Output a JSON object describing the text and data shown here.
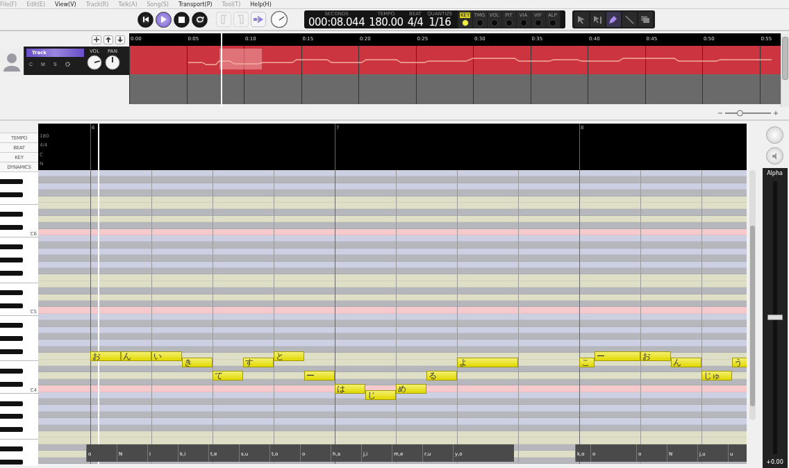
{
  "menu": [
    {
      "label": "File(F)",
      "disabled": true
    },
    {
      "label": "Edit(E)",
      "disabled": true
    },
    {
      "label": "View(V)",
      "disabled": false
    },
    {
      "label": "Track(R)",
      "disabled": true
    },
    {
      "label": "Talk(A)",
      "disabled": true
    },
    {
      "label": "Song(S)",
      "disabled": true
    },
    {
      "label": "Transport(P)",
      "disabled": false
    },
    {
      "label": "Tool(T)",
      "disabled": true
    },
    {
      "label": "Help(H)",
      "disabled": false
    }
  ],
  "transport": [
    {
      "kind": "rewind",
      "selected": false
    },
    {
      "kind": "play",
      "selected": true
    },
    {
      "kind": "stop",
      "selected": false
    },
    {
      "kind": "loop",
      "selected": false
    }
  ],
  "edit_buttons": [
    {
      "kind": "bracket-left",
      "disabled": true
    },
    {
      "kind": "bracket-right",
      "disabled": true
    },
    {
      "kind": "auto-scroll",
      "disabled": false
    }
  ],
  "display": [
    {
      "label": "SECONDS",
      "value": "000:08.044"
    },
    {
      "label": "TEMPO",
      "value": "180.00"
    },
    {
      "label": "BEAT",
      "value": "4/4"
    },
    {
      "label": "QUANTIZE",
      "value": "1/16"
    }
  ],
  "lane_switches": [
    {
      "label": "KEY",
      "on": true
    },
    {
      "label": "TMG",
      "on": false
    },
    {
      "label": "VOL",
      "on": false
    },
    {
      "label": "PIT",
      "on": false
    },
    {
      "label": "VIA",
      "on": false
    },
    {
      "label": "VIF",
      "on": false
    },
    {
      "label": "ALP",
      "on": false
    }
  ],
  "tools": [
    {
      "kind": "arrow",
      "selected": false
    },
    {
      "kind": "range-arrow",
      "selected": false
    },
    {
      "kind": "pencil",
      "selected": true
    },
    {
      "kind": "line",
      "selected": false
    },
    {
      "kind": "layers",
      "selected": false
    }
  ],
  "track": {
    "name": "Track",
    "buttons": [
      "C",
      "M",
      "S"
    ],
    "knobs": [
      "VOL",
      "PAN"
    ]
  },
  "timeline": [
    "0:00",
    "0:05",
    "0:10",
    "0:15",
    "0:20",
    "0:25",
    "0:30",
    "0:35",
    "0:40",
    "0:45",
    "0:50",
    "0:55"
  ],
  "timeline_zoom": {
    "level": 0.3
  },
  "editor": {
    "measures": [
      "6",
      "7",
      "8"
    ],
    "lanes": [
      {
        "label": "TEMPO",
        "value": "180"
      },
      {
        "label": "BEAT",
        "value": "4/4"
      },
      {
        "label": "KEY",
        "value": "C"
      },
      {
        "label": "DYNAMICS",
        "value": "N"
      }
    ],
    "octave_labels": [
      "C6",
      "C5",
      "C4"
    ],
    "notes": [
      {
        "lyric": "お"
      },
      {
        "lyric": "ん"
      },
      {
        "lyric": "い"
      },
      {
        "lyric": "き"
      },
      {
        "lyric": "て"
      },
      {
        "lyric": "す"
      },
      {
        "lyric": "と"
      },
      {
        "lyric": "ー"
      },
      {
        "lyric": "は"
      },
      {
        "lyric": "じ"
      },
      {
        "lyric": "め"
      },
      {
        "lyric": "る"
      },
      {
        "lyric": "よ"
      },
      {
        "lyric": "こ"
      },
      {
        "lyric": "ー"
      },
      {
        "lyric": "お"
      },
      {
        "lyric": "ん"
      },
      {
        "lyric": "じゅ"
      },
      {
        "lyric": "う"
      }
    ],
    "phonemes": [
      "o",
      "N",
      "i",
      "k,i",
      "t,e",
      "s,u",
      "t,o",
      "o",
      "h,a",
      "j,i",
      "m,e",
      "r,u",
      "y,o",
      "k,o",
      "o",
      "o",
      "N",
      "j,u",
      "u"
    ]
  },
  "mixer": {
    "label": "Alpha",
    "value": "+0.00",
    "level": 0.5
  }
}
